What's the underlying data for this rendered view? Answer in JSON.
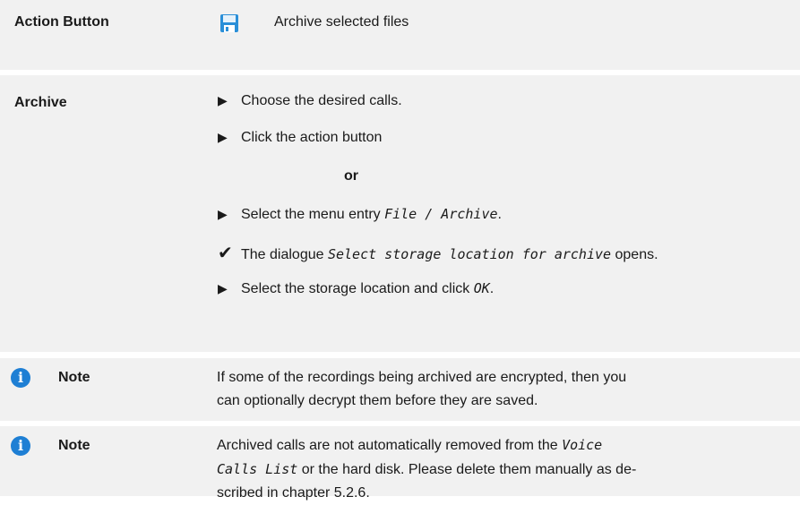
{
  "action_row": {
    "label": "Action Button",
    "icon": "floppy-disk-icon",
    "description": "Archive selected files"
  },
  "archive_row": {
    "label": "Archive",
    "step1": "Choose the desired calls.",
    "step2": "Click the action button",
    "or": "or",
    "step3_prefix": "Select the menu entry ",
    "step3_code": "File / Archive",
    "step3_suffix": ".",
    "result_prefix": "The dialogue ",
    "result_code": "Select storage location for archive",
    "result_suffix": " opens.",
    "step4_prefix": "Select the storage location and click ",
    "step4_code": "OK",
    "step4_suffix": "."
  },
  "note1": {
    "label": "Note",
    "line1": "If some of the recordings being archived are encrypted, then you",
    "line2": "can optionally decrypt them before they are saved."
  },
  "note2": {
    "label": "Note",
    "line1_prefix": "Archived calls are not automatically removed from the ",
    "line1_code": "Voice",
    "line2_code": "Calls List",
    "line2_suffix": " or the hard disk. Please delete them manually as de-",
    "line3": "scribed in chapter 5.2.6."
  },
  "colors": {
    "row_bg": "#f1f1f1",
    "info_icon": "#1e7fd4",
    "floppy": "#2a8fd8"
  }
}
